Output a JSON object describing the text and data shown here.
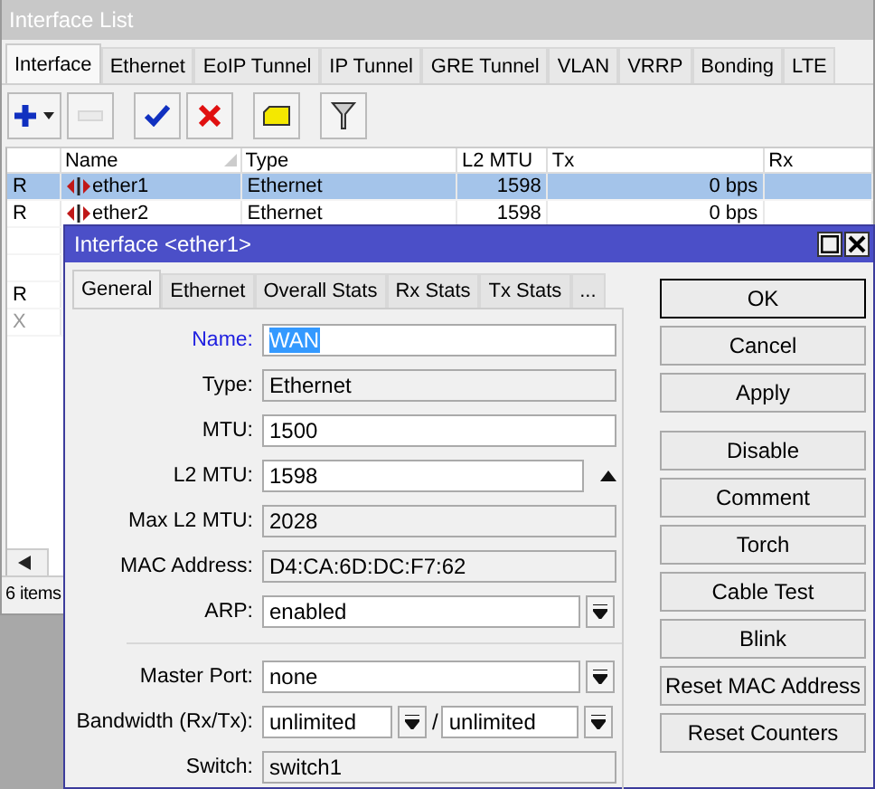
{
  "list_window": {
    "title": "Interface List",
    "tabs": [
      {
        "label": "Interface",
        "selected": true
      },
      {
        "label": "Ethernet",
        "selected": false
      },
      {
        "label": "EoIP Tunnel",
        "selected": false
      },
      {
        "label": "IP Tunnel",
        "selected": false
      },
      {
        "label": "GRE Tunnel",
        "selected": false
      },
      {
        "label": "VLAN",
        "selected": false
      },
      {
        "label": "VRRP",
        "selected": false
      },
      {
        "label": "Bonding",
        "selected": false
      },
      {
        "label": "LTE",
        "selected": false
      }
    ],
    "toolbar": [
      {
        "kind": "add",
        "disabled": false
      },
      {
        "kind": "remove",
        "disabled": true
      },
      {
        "kind": "enable",
        "disabled": false
      },
      {
        "kind": "disable",
        "disabled": false
      },
      {
        "kind": "comment",
        "disabled": false
      },
      {
        "kind": "filter",
        "disabled": false
      }
    ],
    "table": {
      "columns": [
        "",
        "Name",
        "Type",
        "L2 MTU",
        "Tx",
        "Rx"
      ],
      "rows": [
        {
          "flag": "R",
          "name": "ether1",
          "type": "Ethernet",
          "l2mtu": "1598",
          "tx": "0 bps",
          "selected": true,
          "disabled": false
        },
        {
          "flag": "R",
          "name": "ether2",
          "type": "Ethernet",
          "l2mtu": "1598",
          "tx": "0 bps",
          "selected": false,
          "disabled": false
        },
        {
          "flag": "",
          "selected": false
        },
        {
          "flag": "",
          "selected": false
        },
        {
          "flag": "R",
          "selected": false,
          "disabled": false
        },
        {
          "flag": "X",
          "selected": false,
          "disabled": true
        }
      ]
    },
    "status_bar": "6 items"
  },
  "dialog": {
    "title": "Interface <ether1>",
    "tabs": [
      {
        "label": "General",
        "selected": true
      },
      {
        "label": "Ethernet",
        "selected": false
      },
      {
        "label": "Overall Stats",
        "selected": false
      },
      {
        "label": "Rx Stats",
        "selected": false
      },
      {
        "label": "Tx Stats",
        "selected": false
      },
      {
        "label": "...",
        "selected": false
      }
    ],
    "fields": [
      {
        "kind": "text",
        "label": "Name:",
        "value": "WAN",
        "focused": true
      },
      {
        "kind": "readonly",
        "label": "Type:",
        "value": "Ethernet",
        "focused": false
      },
      {
        "kind": "text",
        "label": "MTU:",
        "value": "1500",
        "focused": false
      },
      {
        "kind": "expand",
        "label": "L2 MTU:",
        "value": "1598",
        "focused": false
      },
      {
        "kind": "readonly",
        "label": "Max L2 MTU:",
        "value": "2028",
        "focused": false
      },
      {
        "kind": "readonly",
        "label": "MAC Address:",
        "value": "D4:CA:6D:DC:F7:62",
        "focused": false
      },
      {
        "kind": "dropdown",
        "label": "ARP:",
        "value": "enabled",
        "focused": false
      },
      {
        "kind": "divider"
      },
      {
        "kind": "dropdown",
        "label": "Master Port:",
        "value": "none",
        "focused": false
      },
      {
        "kind": "pair",
        "label": "Bandwidth (Rx/Tx):",
        "values": [
          "unlimited",
          "unlimited"
        ],
        "separator": "/",
        "focused": false
      },
      {
        "kind": "readonly",
        "label": "Switch:",
        "value": "switch1",
        "focused": false
      }
    ],
    "button_groups": [
      [
        {
          "label": "OK",
          "default": true
        },
        {
          "label": "Cancel",
          "default": false
        },
        {
          "label": "Apply",
          "default": false
        }
      ],
      [
        {
          "label": "Disable",
          "default": false
        },
        {
          "label": "Comment",
          "default": false
        },
        {
          "label": "Torch",
          "default": false
        },
        {
          "label": "Cable Test",
          "default": false
        },
        {
          "label": "Blink",
          "default": false
        },
        {
          "label": "Reset MAC Address",
          "default": false
        },
        {
          "label": "Reset Counters",
          "default": false
        }
      ]
    ]
  }
}
